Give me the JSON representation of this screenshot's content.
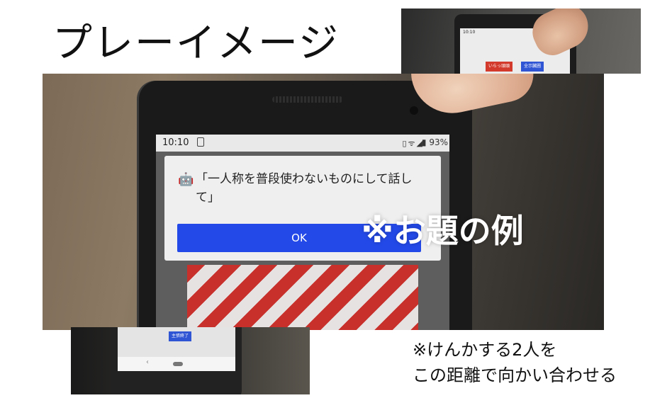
{
  "title": "プレーイメージ",
  "top_photo": {
    "time": "10:10",
    "red_button": "いらっ頭頭",
    "blue_button": "全示臓圃"
  },
  "bottom_photo": {
    "button": "主張終了",
    "back_glyph": "‹"
  },
  "main_photo": {
    "status": {
      "time": "10:10",
      "icons": "▯ᯤ◢",
      "battery": "▮ 93%"
    },
    "dialog": {
      "icon_glyph": "🤖",
      "message": "「一人称を普段使わないものにして話して」",
      "ok_label": "OK"
    },
    "overlay_label": "※お題の例"
  },
  "note": {
    "line1": "※けんかする2人を",
    "line2": "この距離で向かい合わせる"
  },
  "colors": {
    "ok_button": "#2349e8",
    "stripe_red": "#c8302c"
  }
}
